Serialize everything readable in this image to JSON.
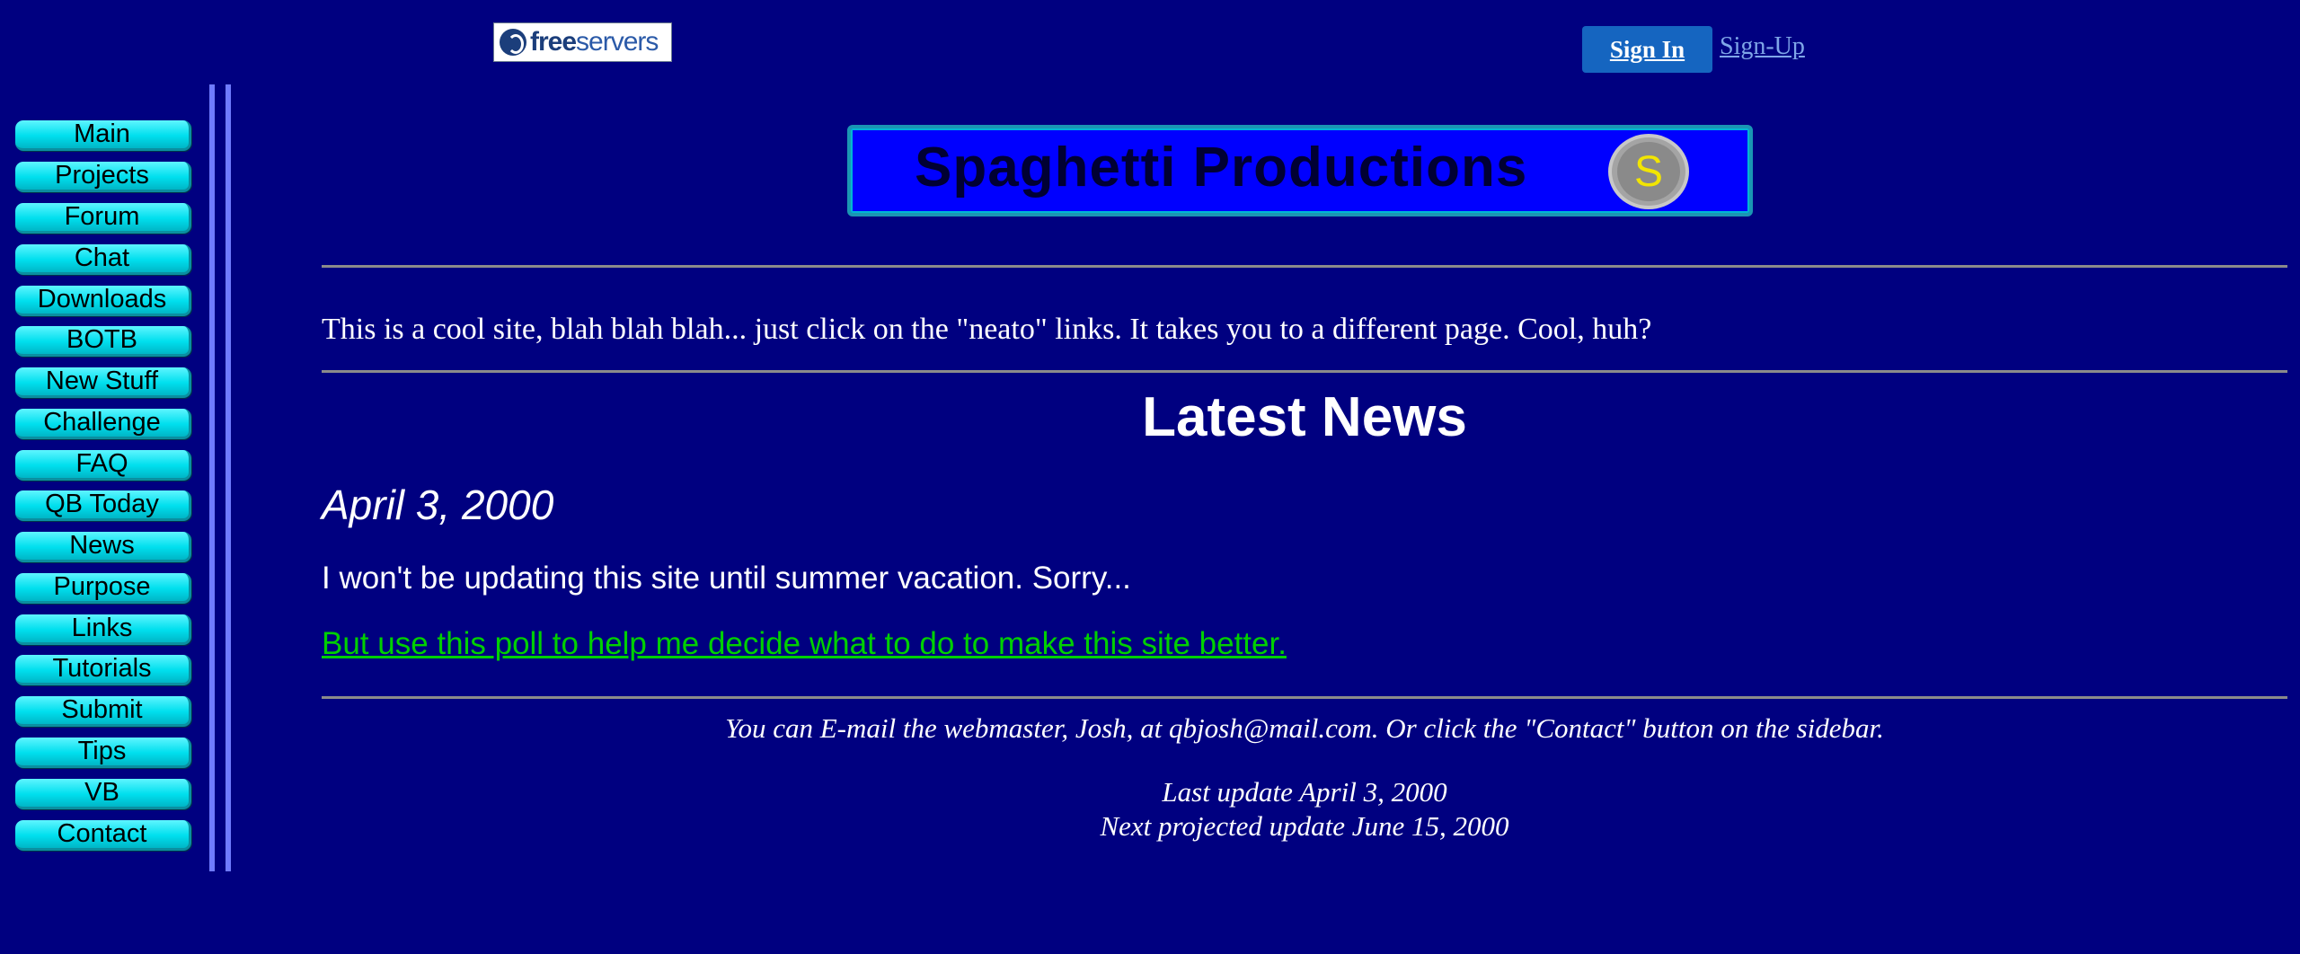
{
  "header": {
    "host_logo_text_bold": "free",
    "host_logo_text": "servers",
    "sign_in_label": "Sign In",
    "sign_up_label": "Sign-Up"
  },
  "sidebar": {
    "items": [
      {
        "label": "Main"
      },
      {
        "label": "Projects"
      },
      {
        "label": "Forum"
      },
      {
        "label": "Chat"
      },
      {
        "label": "Downloads"
      },
      {
        "label": "BOTB"
      },
      {
        "label": "New Stuff"
      },
      {
        "label": "Challenge"
      },
      {
        "label": "FAQ"
      },
      {
        "label": "QB Today"
      },
      {
        "label": "News"
      },
      {
        "label": "Purpose"
      },
      {
        "label": "Links"
      },
      {
        "label": "Tutorials"
      },
      {
        "label": "Submit"
      },
      {
        "label": "Tips"
      },
      {
        "label": "VB"
      },
      {
        "label": "Contact"
      }
    ]
  },
  "banner": {
    "title": "Spaghetti Productions",
    "logo_letter": "S"
  },
  "main": {
    "intro": "This is a cool site, blah blah blah... just click on the \"neato\" links.  It takes you to a different page.  Cool, huh?",
    "news_heading": "Latest News",
    "news_date": "April 3, 2000",
    "news_body": "I won't be updating this site until summer vacation. Sorry...",
    "news_link": "But use this poll to help me decide what to do to make this site better."
  },
  "footer": {
    "contact": "You can E-mail the webmaster, Josh, at qbjosh@mail.com.  Or click the \"Contact\" button on the sidebar.",
    "last_update": "Last update April 3, 2000",
    "next_update": "Next projected update June 15, 2000"
  },
  "colors": {
    "background": "#000080",
    "nav_button": "#00e5f5",
    "link_green": "#00d000",
    "banner_blue": "#0000ff"
  }
}
